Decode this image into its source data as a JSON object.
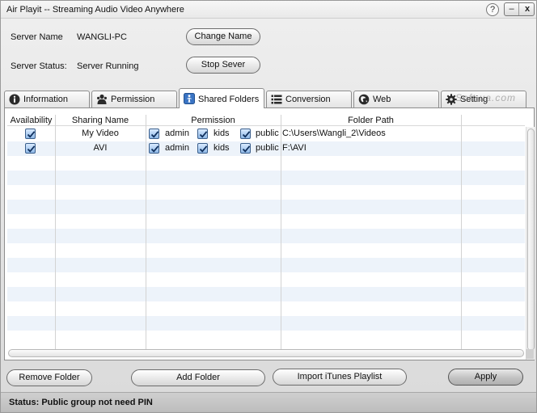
{
  "window": {
    "title": "Air Playit -- Streaming Audio Video Anywhere",
    "help_label": "?",
    "minimize_label": "–",
    "close_label": "x"
  },
  "server": {
    "name_label": "Server Name",
    "name_value": "WANGLI-PC",
    "status_label": "Server Status:",
    "status_value": "Server Running",
    "change_name_button": "Change Name",
    "stop_server_button": "Stop Sever"
  },
  "tabs": [
    {
      "label": "Information",
      "icon": "info-icon",
      "active": false
    },
    {
      "label": "Permission",
      "icon": "users-icon",
      "active": false
    },
    {
      "label": "Shared Folders",
      "icon": "shared-folder-icon",
      "active": true
    },
    {
      "label": "Conversion",
      "icon": "list-icon",
      "active": false
    },
    {
      "label": "Web",
      "icon": "globe-icon",
      "active": false
    },
    {
      "label": "Setting",
      "icon": "gear-icon",
      "active": false
    }
  ],
  "watermark": "Soft.ua.com",
  "table": {
    "headers": [
      "Availability",
      "Sharing Name",
      "Permission",
      "Folder Path"
    ],
    "rows": [
      {
        "available": true,
        "name": "My Video",
        "permissions": [
          {
            "label": "admin",
            "checked": true
          },
          {
            "label": "kids",
            "checked": true
          },
          {
            "label": "public",
            "checked": true
          }
        ],
        "path": "C:\\Users\\Wangli_2\\Videos"
      },
      {
        "available": true,
        "name": "AVI",
        "permissions": [
          {
            "label": "admin",
            "checked": true
          },
          {
            "label": "kids",
            "checked": true
          },
          {
            "label": "public",
            "checked": true
          }
        ],
        "path": "F:\\AVI"
      }
    ]
  },
  "buttons": {
    "remove_folder": "Remove Folder",
    "add_folder": "Add Folder",
    "import_itunes": "Import iTunes Playlist",
    "apply": "Apply"
  },
  "status": {
    "text": "Status:  Public group not need PIN"
  },
  "colors": {
    "checkbox": "#6f9fd8",
    "row_alt": "#edf3fa",
    "active_tab_icon": "#3a74c4"
  }
}
